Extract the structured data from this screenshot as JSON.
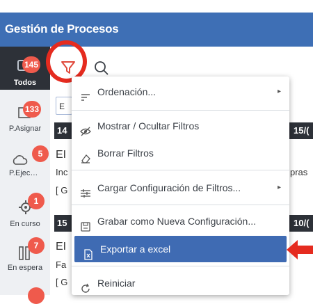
{
  "header": {
    "title": "Gestión de Procesos"
  },
  "sidebar": {
    "items": [
      {
        "badge": "145",
        "label": "Todos",
        "icon": "all-icon"
      },
      {
        "badge": "133",
        "label": "P.Asignar",
        "icon": "assign-icon"
      },
      {
        "badge": "5",
        "label": "P.Ejec…",
        "icon": "cloud-icon"
      },
      {
        "badge": "1",
        "label": "En curso",
        "icon": "gear-icon"
      },
      {
        "badge": "7",
        "label": "En espera",
        "icon": "pause-icon"
      }
    ]
  },
  "toolbar": {
    "filter_icon": "funnel-icon",
    "search_icon": "search-icon"
  },
  "background": {
    "field_letter": "E",
    "row1_left": "14",
    "row1_right": "15/(",
    "card1_title": "EI",
    "card1_line": "Inc",
    "card1_right": "pras",
    "card1_tag": "[ G",
    "row2_left": "15",
    "row2_right": "10/(",
    "card2_title": "EI",
    "card2_line": "Fa",
    "card2_tag": "[ G"
  },
  "menu": {
    "items": [
      {
        "label": "Ordenación...",
        "icon": "sort-icon",
        "submenu": true
      },
      {
        "label": "Mostrar / Ocultar Filtros",
        "icon": "eye-off-icon",
        "submenu": false
      },
      {
        "label": "Borrar Filtros",
        "icon": "eraser-icon",
        "submenu": false
      },
      {
        "label": "Cargar Configuración de Filtros...",
        "icon": "sliders-icon",
        "submenu": true
      },
      {
        "label": "Grabar como Nueva Configuración...",
        "icon": "save-icon",
        "submenu": false
      },
      {
        "label": "Exportar a excel",
        "icon": "excel-file-icon",
        "submenu": false,
        "highlighted": true
      },
      {
        "label": "Reiniciar",
        "icon": "refresh-icon",
        "submenu": false
      }
    ],
    "submenu_arrow": "▸"
  },
  "colors": {
    "header_bg": "#3e6fb5",
    "highlight_bg": "#3f6bb3",
    "badge": "#ef5a4c",
    "annotation_red": "#e52b1f",
    "dark_row": "#2d3138"
  }
}
